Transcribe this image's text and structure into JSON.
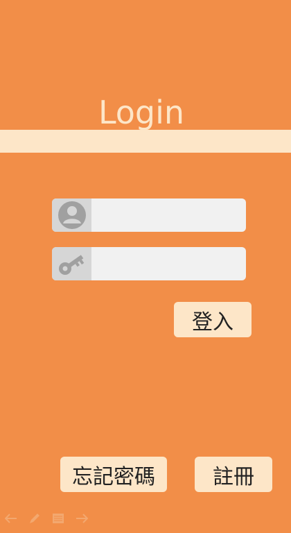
{
  "title": "Login",
  "username": {
    "value": "",
    "placeholder": ""
  },
  "password": {
    "value": "",
    "placeholder": ""
  },
  "buttons": {
    "login": "登入",
    "forgot_password": "忘記密碼",
    "register": "註冊"
  },
  "icons": {
    "username": "user-avatar-icon",
    "password": "key-icon",
    "toolbar": [
      "arrow-left-icon",
      "pen-icon",
      "menu-icon",
      "arrow-right-icon"
    ]
  },
  "colors": {
    "background": "#F28E48",
    "accent_light": "#FDE6C8",
    "field": "#F1F1F1",
    "icon_box": "#D6D6D6"
  }
}
